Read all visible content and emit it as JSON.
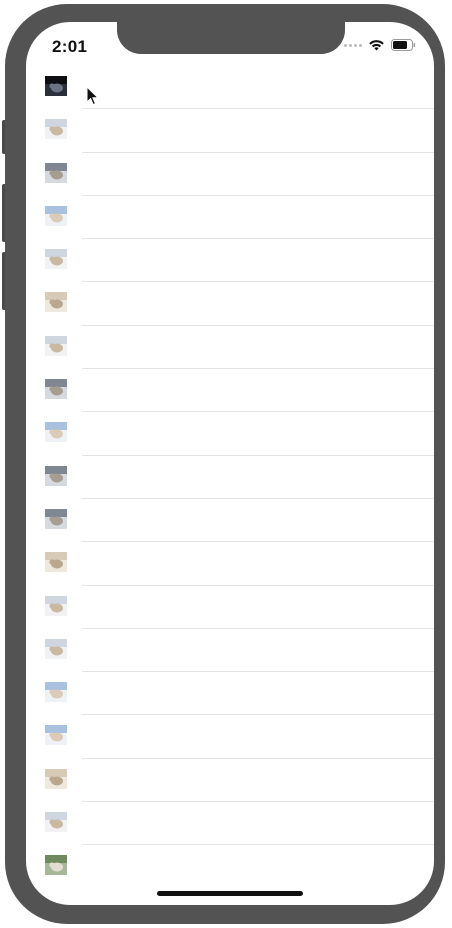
{
  "status_bar": {
    "time": "2:01"
  },
  "list": {
    "items": [
      {
        "name": "thumbnail-1",
        "tone": "dark"
      },
      {
        "name": "thumbnail-2",
        "tone": "snow"
      },
      {
        "name": "thumbnail-3",
        "tone": "grey"
      },
      {
        "name": "thumbnail-4",
        "tone": "sky"
      },
      {
        "name": "thumbnail-5",
        "tone": "snow"
      },
      {
        "name": "thumbnail-6",
        "tone": "beige"
      },
      {
        "name": "thumbnail-7",
        "tone": "snow"
      },
      {
        "name": "thumbnail-8",
        "tone": "grey"
      },
      {
        "name": "thumbnail-9",
        "tone": "sky"
      },
      {
        "name": "thumbnail-10",
        "tone": "grey"
      },
      {
        "name": "thumbnail-11",
        "tone": "grey"
      },
      {
        "name": "thumbnail-12",
        "tone": "beige"
      },
      {
        "name": "thumbnail-13",
        "tone": "snow"
      },
      {
        "name": "thumbnail-14",
        "tone": "snow"
      },
      {
        "name": "thumbnail-15",
        "tone": "sky"
      },
      {
        "name": "thumbnail-16",
        "tone": "sky"
      },
      {
        "name": "thumbnail-17",
        "tone": "beige"
      },
      {
        "name": "thumbnail-18",
        "tone": "snow"
      },
      {
        "name": "thumbnail-19",
        "tone": "green"
      }
    ]
  },
  "colors": {
    "device_frame": "#535353",
    "separator": "#e3e3e3",
    "background": "#ffffff"
  }
}
